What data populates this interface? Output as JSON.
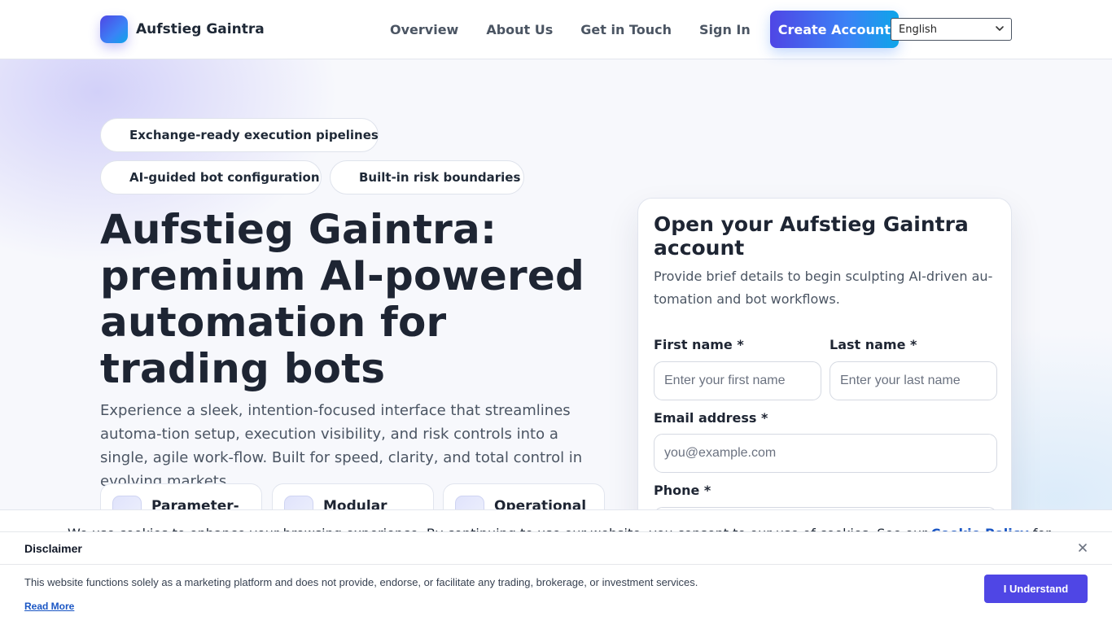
{
  "header": {
    "brand": "Aufstieg Gaintra",
    "nav": [
      "Overview",
      "About Us",
      "Get in Touch",
      "Sign In"
    ],
    "cta": "Create Account",
    "language": "English"
  },
  "hero": {
    "pills": [
      "Exchange-ready execution pipelines",
      "AI-guided bot configuration",
      "Built-in risk boundaries"
    ],
    "title": "Aufstieg Gaintra: premium AI-powered automation for trading bots",
    "description": "Experience a sleek, intention-focused interface that streamlines automa-tion setup, execution visibility, and risk controls into a single, agile work-flow. Built for speed, clarity, and total control in evolving markets.",
    "features": [
      "Parameter-",
      "Modular",
      "Operational"
    ]
  },
  "form": {
    "title": "Open your Aufstieg Gaintra account",
    "subtitle": "Provide brief details to begin sculpting AI-driven au-tomation and bot workflows.",
    "first_name_label": "First name *",
    "first_name_placeholder": "Enter your first name",
    "last_name_label": "Last name *",
    "last_name_placeholder": "Enter your last name",
    "email_label": "Email address *",
    "email_placeholder": "you@example.com",
    "phone_label": "Phone *"
  },
  "cookie": {
    "text": "We use cookies to enhance your browsing experience. By continuing to use our website, you consent to our use of cookies. See our",
    "link": "Cookie Policy",
    "tail": "for"
  },
  "disclaimer": {
    "title": "Disclaimer",
    "body": "This website functions solely as a marketing platform and does not provide, endorse, or facilitate any trading, brokerage, or investment services.",
    "read_more": "Read More",
    "button": "I Understand"
  }
}
